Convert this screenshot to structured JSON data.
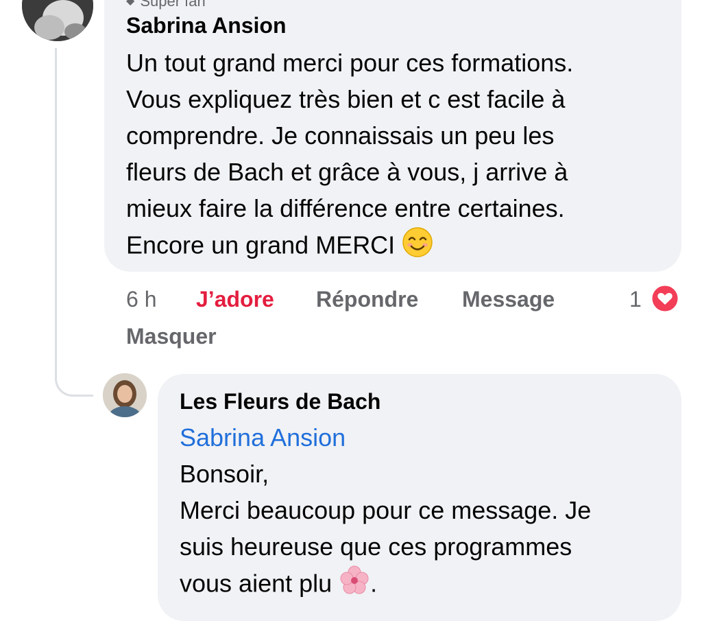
{
  "top_comment": {
    "badge": "Super fan",
    "author": "Sabrina Ansion",
    "lines": [
      "Un tout grand merci pour ces formations.",
      "Vous expliquez très bien et c est facile à",
      "comprendre. Je connaissais un peu les",
      "fleurs de Bach et grâce à vous, j arrive à",
      "mieux faire la différence entre certaines.",
      "Encore un grand MERCI"
    ],
    "emoji": "smiling-face-emoji",
    "actions": {
      "time": "6 h",
      "like": "J’adore",
      "reply": "Répondre",
      "message": "Message",
      "hide": "Masquer"
    },
    "reaction_count": "1",
    "reaction_type": "love-reaction-icon"
  },
  "reply_comment": {
    "author": "Les Fleurs de Bach",
    "mention": "Sabrina Ansion",
    "lines": [
      "Bonsoir,",
      "Merci beaucoup pour ce message. Je",
      "suis heureuse que ces programmes",
      "vous aient plu",
      "."
    ],
    "emoji": "cherry-blossom-emoji"
  },
  "colors": {
    "bubble": "#f0f2f5",
    "like_active": "#e41e3f",
    "mention": "#216fdb",
    "secondary_text": "#65676b"
  }
}
